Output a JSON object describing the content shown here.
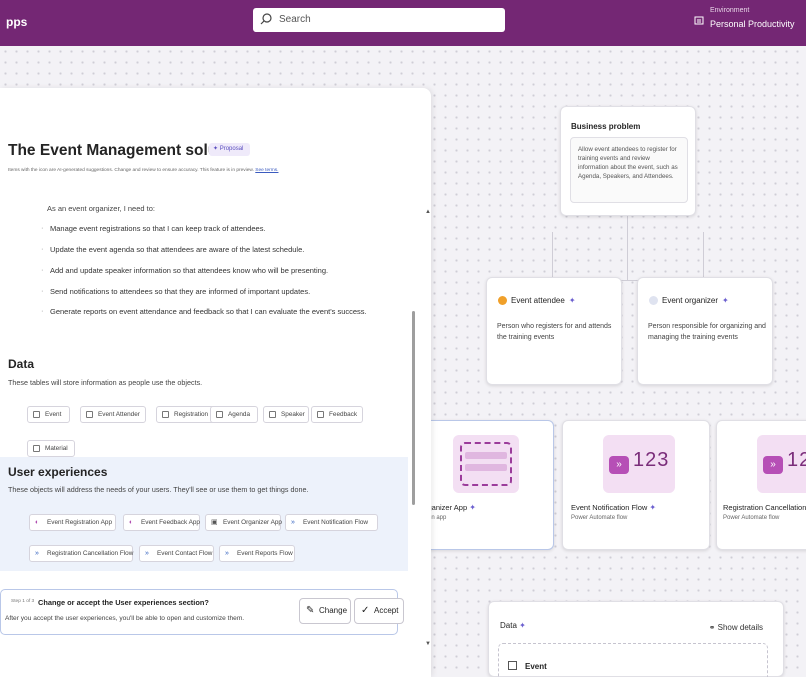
{
  "topbar": {
    "app_name": "pps",
    "search_placeholder": "Search",
    "env_label": "Environment",
    "env_name": "Personal Productivity"
  },
  "canvas": {
    "business_problem": {
      "title": "Business problem",
      "body": "Allow event attendees to register for training events and review information about the event, such as Agenda, Speakers, and Attendees."
    },
    "personas": [
      {
        "name": "Event attendee",
        "desc": "Person who registers for and attends the training events"
      },
      {
        "name": "Event organizer",
        "desc": "Person responsible for organizing and managing the training events"
      }
    ],
    "apps": [
      {
        "name": "t Organizer App",
        "sub": "l-driven app"
      },
      {
        "name": "Event Notification Flow",
        "sub": "Power Automate flow"
      },
      {
        "name": "Registration Cancellation Fl",
        "sub": "Power Automate flow"
      }
    ],
    "flow_digits": "123",
    "data_card": {
      "title": "Data",
      "show_details": "Show details",
      "first_table": "Event"
    }
  },
  "panel": {
    "title": "The Event Management solution",
    "badge": "Proposal",
    "note": "Items with the  icon are AI-generated suggestions. Change and review to ensure accuracy. This feature is in preview.",
    "note_link": "See terms.",
    "intro": "As an event organizer, I need to:",
    "bullets": [
      "Manage event registrations so that I can keep track of attendees.",
      "Update the event agenda so that attendees are aware of the latest schedule.",
      "Add and update speaker information so that attendees know who will be presenting.",
      "Send notifications to attendees so that they are informed of important updates.",
      "Generate reports on event attendance and feedback so that I can evaluate the event's success."
    ],
    "data_heading": "Data",
    "data_desc": "These tables will store information as people use the objects.",
    "data_tables": [
      "Event",
      "Event Attender",
      "Registration",
      "Agenda",
      "Speaker",
      "Feedback",
      "Material"
    ],
    "ux_heading": "User experiences",
    "ux_desc": "These objects will address the needs of your users. They'll see or use them to get things done.",
    "ux_items": [
      "Event Registration App",
      "Event Feedback App",
      "Event Organizer App",
      "Event Notification Flow",
      "Registration Cancellation Flow",
      "Event Contact Flow",
      "Event Reports Flow"
    ],
    "accept": {
      "step": "Step 1 of 3",
      "question": "Change or accept the User experiences section?",
      "desc": "After you accept the user experiences, you'll be able to open and customize them.",
      "change_label": "Change",
      "accept_label": "Accept"
    }
  },
  "colors": {
    "brand": "#742774",
    "accent": "#6b5fcf",
    "ux_band": "#edf2fb"
  }
}
